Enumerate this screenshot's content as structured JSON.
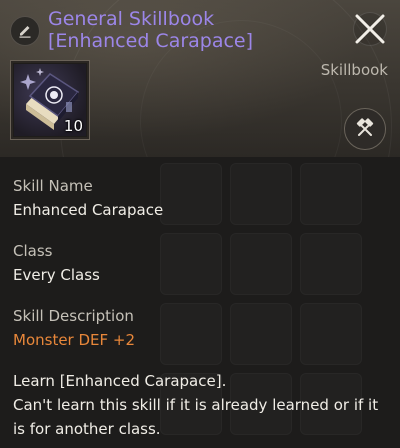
{
  "header": {
    "title": "General Skillbook [Enhanced Carapace]",
    "category": "Skillbook",
    "item_count": "10",
    "edit_icon": "pencil-icon",
    "close_icon": "close-icon",
    "disassemble_icon": "crossed-hammers-icon"
  },
  "details": {
    "skill_name_label": "Skill Name",
    "skill_name_value": "Enhanced Carapace",
    "class_label": "Class",
    "class_value": "Every Class",
    "skill_description_label": "Skill Description",
    "skill_description_value": "Monster DEF +2",
    "learn_line": "Learn [Enhanced Carapace].",
    "restriction_line": "Can't learn this skill if it is already learned or if it is for another class."
  },
  "colors": {
    "title": "#9c86e8",
    "description_value": "#e8873a",
    "text": "#f0ede6",
    "label": "#c5c1b8"
  }
}
